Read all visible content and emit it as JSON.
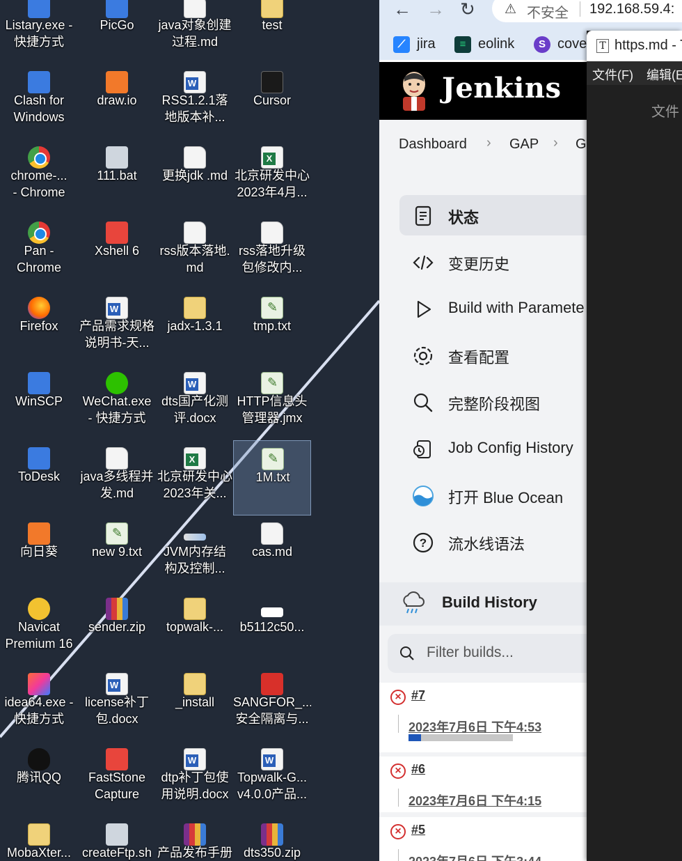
{
  "desktop": {
    "icons": [
      {
        "label": "Listary.exe -\n快捷方式"
      },
      {
        "label": "PicGo"
      },
      {
        "label": "java对象创建\n过程.md"
      },
      {
        "label": "test"
      },
      {
        "label": "Clash for\nWindows"
      },
      {
        "label": "draw.io"
      },
      {
        "label": "RSS1.2.1落\n地版本补..."
      },
      {
        "label": "Cursor"
      },
      {
        "label": "chrome-...\n- Chrome"
      },
      {
        "label": "111.bat"
      },
      {
        "label": "更换jdk .md"
      },
      {
        "label": "北京研发中心\n2023年4月..."
      },
      {
        "label": "Pan -\nChrome"
      },
      {
        "label": "Xshell 6"
      },
      {
        "label": "rss版本落地.\nmd"
      },
      {
        "label": "rss落地升级\n包修改内..."
      },
      {
        "label": "Firefox"
      },
      {
        "label": "产品需求规格\n说明书-天..."
      },
      {
        "label": "jadx-1.3.1"
      },
      {
        "label": "tmp.txt"
      },
      {
        "label": "WinSCP"
      },
      {
        "label": "WeChat.exe\n- 快捷方式"
      },
      {
        "label": "dts国产化测\n评.docx"
      },
      {
        "label": "HTTP信息头\n管理器.jmx"
      },
      {
        "label": "ToDesk"
      },
      {
        "label": "java多线程并\n发.md"
      },
      {
        "label": "北京研发中心\n2023年关..."
      },
      {
        "label": "1M.txt"
      },
      {
        "label": "向日葵"
      },
      {
        "label": "new 9.txt"
      },
      {
        "label": "JVM内存结\n构及控制..."
      },
      {
        "label": "cas.md"
      },
      {
        "label": "Navicat\nPremium 16"
      },
      {
        "label": "sender.zip"
      },
      {
        "label": "topwalk-..."
      },
      {
        "label": "b5112c50..."
      },
      {
        "label": "idea64.exe -\n快捷方式"
      },
      {
        "label": "license补丁\n包.docx"
      },
      {
        "label": "_install"
      },
      {
        "label": "SANGFOR_...\n安全隔离与..."
      },
      {
        "label": "腾讯QQ"
      },
      {
        "label": "FastStone\nCapture"
      },
      {
        "label": "dtp补丁包使\n用说明.docx"
      },
      {
        "label": "Topwalk-G...\nv4.0.0产品..."
      },
      {
        "label": "MobaXter..."
      },
      {
        "label": "createFtp.sh"
      },
      {
        "label": "产品发布手册"
      },
      {
        "label": "dts350.zip"
      }
    ]
  },
  "browser": {
    "omnibox": {
      "security": "不安全",
      "url": "192.168.59.4:"
    },
    "bookmarks": [
      "jira",
      "eolink",
      "cove"
    ]
  },
  "jenkins": {
    "logo": "Jenkins",
    "breadcrumbs": [
      "Dashboard",
      "GAP",
      "G"
    ],
    "nav": [
      {
        "label": "状态"
      },
      {
        "label": "变更历史"
      },
      {
        "label": "Build with Paramete"
      },
      {
        "label": "查看配置"
      },
      {
        "label": "完整阶段视图"
      },
      {
        "label": "Job Config History"
      },
      {
        "label": "打开 Blue Ocean"
      },
      {
        "label": "流水线语法"
      }
    ],
    "build_history": {
      "title": "Build History",
      "filter_placeholder": "Filter builds...",
      "builds": [
        {
          "number": "#7",
          "date": "2023年7月6日 下午4:53",
          "progress": 0.12
        },
        {
          "number": "#6",
          "date": "2023年7月6日 下午4:15"
        },
        {
          "number": "#5",
          "date": "2023年7月6日 下午3:44"
        }
      ]
    }
  },
  "overlay": {
    "tab_title": "https.md - T",
    "menu": [
      "文件(F)",
      "编辑(E"
    ],
    "subtitle": "文件"
  },
  "colors": {
    "desktop_bg": "#222a37",
    "jenkins_header": "#000000",
    "build_failed": "#d32f2f",
    "progress": "#1e56b8"
  }
}
